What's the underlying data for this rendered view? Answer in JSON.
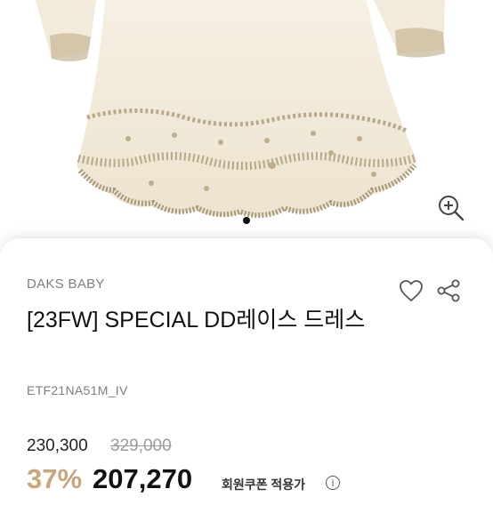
{
  "product": {
    "brand": "DAKS BABY",
    "title": "[23FW] SPECIAL DD레이스 드레스",
    "code": "ETF21NA51M_IV",
    "price_sale": "230,300",
    "price_original": "329,000",
    "discount": "37%",
    "final_price": "207,270",
    "coupon_label": "회원쿠폰 적용가",
    "info_mark": "i"
  },
  "gallery": {
    "active_index": 0,
    "total": 1
  },
  "icons": [
    "zoom-in-icon",
    "heart-icon",
    "share-icon",
    "info-icon"
  ],
  "colors": {
    "accent": "#c9a57a",
    "dress": "#f3ecdd",
    "lace": "#b8a889"
  }
}
